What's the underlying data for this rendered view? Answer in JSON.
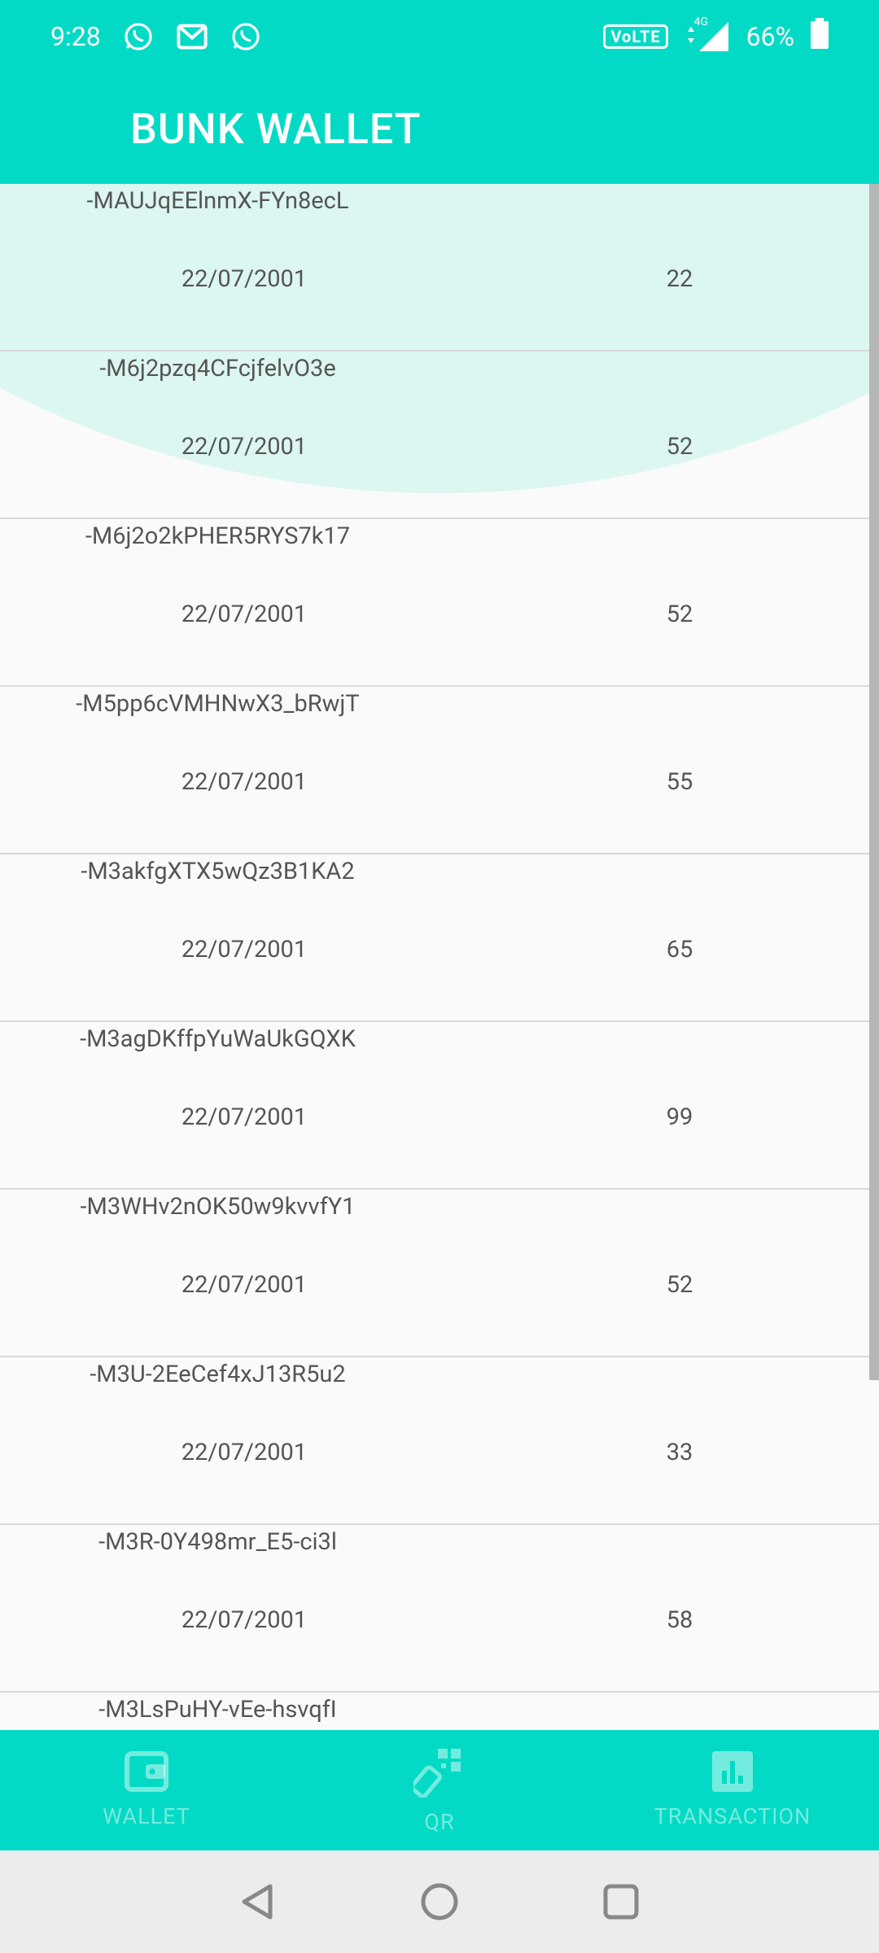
{
  "status_bar": {
    "time": "9:28",
    "volte": "VoLTE",
    "network": "4G",
    "battery": "66%"
  },
  "app": {
    "title": "BUNK WALLET"
  },
  "transactions": [
    {
      "id": "-MAUJqEElnmX-FYn8ecL",
      "date": "22/07/2001",
      "amount": "22"
    },
    {
      "id": "-M6j2pzq4CFcjfelvO3e",
      "date": "22/07/2001",
      "amount": "52"
    },
    {
      "id": "-M6j2o2kPHER5RYS7k17",
      "date": "22/07/2001",
      "amount": "52"
    },
    {
      "id": "-M5pp6cVMHNwX3_bRwjT",
      "date": "22/07/2001",
      "amount": "55"
    },
    {
      "id": "-M3akfgXTX5wQz3B1KA2",
      "date": "22/07/2001",
      "amount": "65"
    },
    {
      "id": "-M3agDKffpYuWaUkGQXK",
      "date": "22/07/2001",
      "amount": "99"
    },
    {
      "id": "-M3WHv2nOK50w9kvvfY1",
      "date": "22/07/2001",
      "amount": "52"
    },
    {
      "id": "-M3U-2EeCef4xJ13R5u2",
      "date": "22/07/2001",
      "amount": "33"
    },
    {
      "id": "-M3R-0Y498mr_E5-ci3l",
      "date": "22/07/2001",
      "amount": "58"
    },
    {
      "id": "-M3LsPuHY-vEe-hsvqfI",
      "date": "",
      "amount": ""
    }
  ],
  "bottom_nav": {
    "items": [
      {
        "label": "WALLET",
        "icon": "wallet-icon"
      },
      {
        "label": "QR",
        "icon": "qr-scan-icon"
      },
      {
        "label": "TRANSACTION",
        "icon": "bar-chart-icon"
      }
    ]
  },
  "colors": {
    "primary": "#03dac5",
    "arc": "#dcf6f1",
    "background": "#fafafa"
  }
}
